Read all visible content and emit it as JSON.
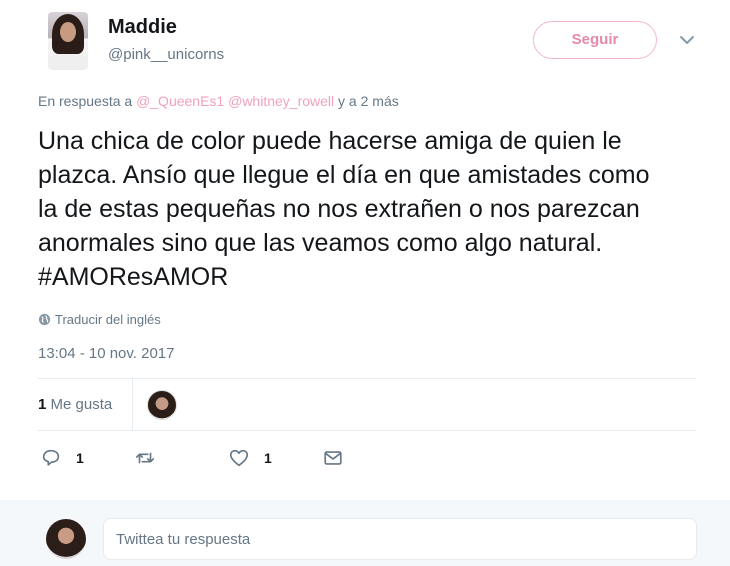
{
  "author": {
    "name": "Maddie",
    "handle": "@pink__unicorns"
  },
  "follow_button": {
    "label": "Seguir"
  },
  "reply_context": {
    "prefix": "En respuesta a",
    "mention_1": "@_QueenEs1",
    "mention_2": "@whitney_rowell",
    "suffix": "y a 2 más"
  },
  "tweet": {
    "lines": [
      "Una chica de color puede hacerse amiga de quien le",
      "plazca. Ansío que llegue el día en que amistades como",
      "la de estas pequeñas no nos extrañen o nos parezcan",
      "anormales sino que las veamos como algo natural.",
      "#AMOResAMOR"
    ]
  },
  "translate": {
    "label": "Traducir del inglés",
    "icon": "globe-icon"
  },
  "timestamp": "13:04 - 10 nov. 2017",
  "stats": {
    "likes_count": "1",
    "likes_label": "Me gusta"
  },
  "actions": {
    "reply_count": "1",
    "retweet_count": "",
    "like_count": "1"
  },
  "reply_box": {
    "placeholder": "Twittea tu respuesta"
  },
  "colors": {
    "accent_pink": "#e58aa8",
    "mention_pink": "#f0a2bc",
    "muted_text": "#657786",
    "divider": "#e6ecf0",
    "reply_bg": "#f5f8fa"
  }
}
